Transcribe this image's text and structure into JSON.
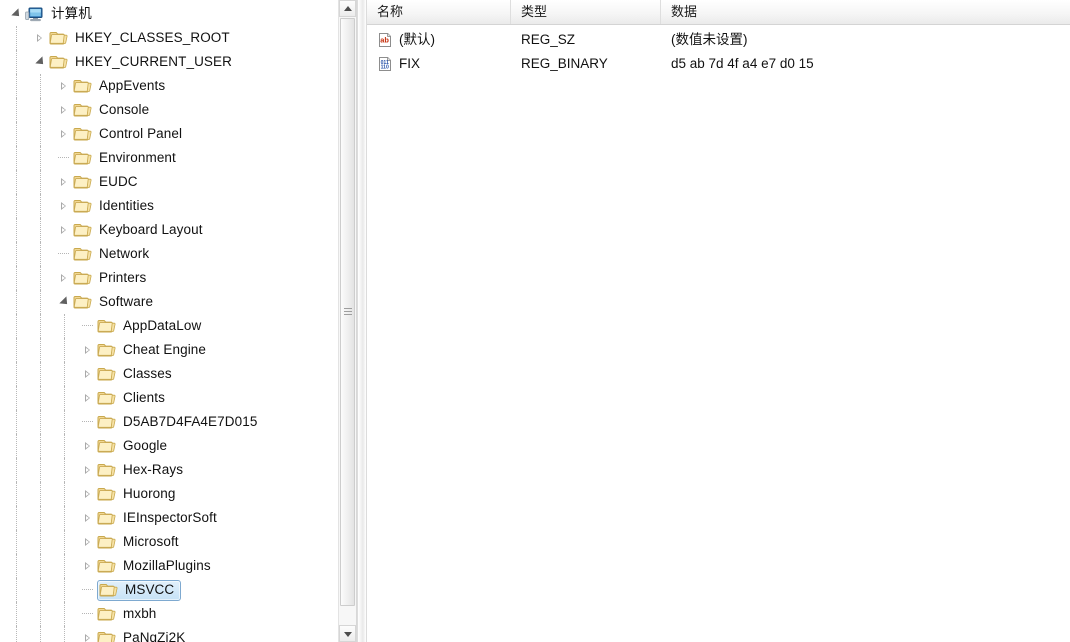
{
  "tree": {
    "root": {
      "label": "计算机",
      "icon": "computer-icon",
      "state": "expanded",
      "depth": 0
    },
    "items": [
      {
        "label": "计算机",
        "icon": "computer-icon",
        "state": "expanded",
        "depth": 0,
        "selected": false
      },
      {
        "label": "HKEY_CLASSES_ROOT",
        "icon": "folder-icon",
        "state": "collapsed",
        "depth": 1,
        "selected": false
      },
      {
        "label": "HKEY_CURRENT_USER",
        "icon": "folder-icon",
        "state": "expanded",
        "depth": 1,
        "selected": false
      },
      {
        "label": "AppEvents",
        "icon": "folder-icon",
        "state": "collapsed",
        "depth": 2,
        "selected": false
      },
      {
        "label": "Console",
        "icon": "folder-icon",
        "state": "collapsed",
        "depth": 2,
        "selected": false
      },
      {
        "label": "Control Panel",
        "icon": "folder-icon",
        "state": "collapsed",
        "depth": 2,
        "selected": false
      },
      {
        "label": "Environment",
        "icon": "folder-icon",
        "state": "leaf",
        "depth": 2,
        "selected": false
      },
      {
        "label": "EUDC",
        "icon": "folder-icon",
        "state": "collapsed",
        "depth": 2,
        "selected": false
      },
      {
        "label": "Identities",
        "icon": "folder-icon",
        "state": "collapsed",
        "depth": 2,
        "selected": false
      },
      {
        "label": "Keyboard Layout",
        "icon": "folder-icon",
        "state": "collapsed",
        "depth": 2,
        "selected": false
      },
      {
        "label": "Network",
        "icon": "folder-icon",
        "state": "leaf",
        "depth": 2,
        "selected": false
      },
      {
        "label": "Printers",
        "icon": "folder-icon",
        "state": "collapsed",
        "depth": 2,
        "selected": false
      },
      {
        "label": "Software",
        "icon": "folder-icon",
        "state": "expanded",
        "depth": 2,
        "selected": false
      },
      {
        "label": "AppDataLow",
        "icon": "folder-icon",
        "state": "leaf",
        "depth": 3,
        "selected": false
      },
      {
        "label": "Cheat Engine",
        "icon": "folder-icon",
        "state": "collapsed",
        "depth": 3,
        "selected": false
      },
      {
        "label": "Classes",
        "icon": "folder-icon",
        "state": "collapsed",
        "depth": 3,
        "selected": false
      },
      {
        "label": "Clients",
        "icon": "folder-icon",
        "state": "collapsed",
        "depth": 3,
        "selected": false
      },
      {
        "label": "D5AB7D4FA4E7D015",
        "icon": "folder-icon",
        "state": "leaf",
        "depth": 3,
        "selected": false
      },
      {
        "label": "Google",
        "icon": "folder-icon",
        "state": "collapsed",
        "depth": 3,
        "selected": false
      },
      {
        "label": "Hex-Rays",
        "icon": "folder-icon",
        "state": "collapsed",
        "depth": 3,
        "selected": false
      },
      {
        "label": "Huorong",
        "icon": "folder-icon",
        "state": "collapsed",
        "depth": 3,
        "selected": false
      },
      {
        "label": "IEInspectorSoft",
        "icon": "folder-icon",
        "state": "collapsed",
        "depth": 3,
        "selected": false
      },
      {
        "label": "Microsoft",
        "icon": "folder-icon",
        "state": "collapsed",
        "depth": 3,
        "selected": false
      },
      {
        "label": "MozillaPlugins",
        "icon": "folder-icon",
        "state": "collapsed",
        "depth": 3,
        "selected": false
      },
      {
        "label": "MSVCC",
        "icon": "folder-icon",
        "state": "leaf",
        "depth": 3,
        "selected": true
      },
      {
        "label": "mxbh",
        "icon": "folder-icon",
        "state": "leaf",
        "depth": 3,
        "selected": false
      },
      {
        "label": "PaNqZi2K",
        "icon": "folder-icon",
        "state": "collapsed",
        "depth": 3,
        "selected": false
      }
    ]
  },
  "tree_scrollbar": {
    "up_arrow_icon": "scroll-up-arrow-icon",
    "down_arrow_icon": "scroll-down-arrow-icon",
    "grip_icon": "scrollbar-grip-icon"
  },
  "values_list": {
    "columns": [
      {
        "key": "name",
        "label": "名称"
      },
      {
        "key": "type",
        "label": "类型"
      },
      {
        "key": "data",
        "label": "数据"
      }
    ],
    "rows": [
      {
        "name": "(默认)",
        "type": "REG_SZ",
        "data": "(数值未设置)",
        "icon": "string-value-icon"
      },
      {
        "name": "FIX",
        "type": "REG_BINARY",
        "data": "d5 ab 7d 4f a4 e7 d0 15",
        "icon": "binary-value-icon"
      }
    ]
  },
  "colors": {
    "selection_fill": "#cfe6f7",
    "selection_border": "#7ea9d0",
    "folder_yellow": "#f5dd9a",
    "string_icon_red": "#cc2200",
    "binary_icon_blue": "#2255bb",
    "header_bg": "#f2f2f2",
    "window_bg": "#ffffff"
  }
}
